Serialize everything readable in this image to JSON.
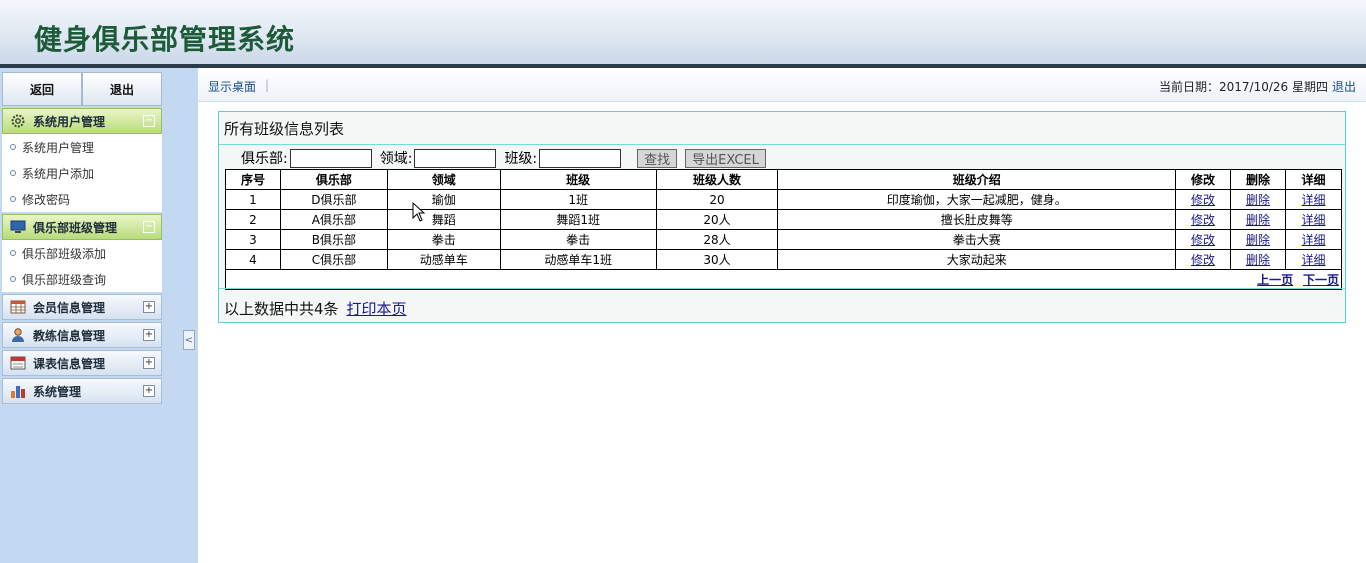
{
  "header": {
    "title": "健身俱乐部管理系统"
  },
  "sidebar": {
    "buttons": {
      "back": "返回",
      "exit": "退出"
    },
    "groups": [
      {
        "label": "系统用户管理",
        "open": true,
        "icon": "gear-icon",
        "toggle": "−",
        "items": [
          "系统用户管理",
          "系统用户添加",
          "修改密码"
        ]
      },
      {
        "label": "俱乐部班级管理",
        "open": true,
        "icon": "monitor-icon",
        "toggle": "−",
        "items": [
          "俱乐部班级添加",
          "俱乐部班级查询"
        ]
      },
      {
        "label": "会员信息管理",
        "open": false,
        "icon": "table-icon",
        "toggle": "+"
      },
      {
        "label": "教练信息管理",
        "open": false,
        "icon": "person-icon",
        "toggle": "+"
      },
      {
        "label": "课表信息管理",
        "open": false,
        "icon": "calendar-icon",
        "toggle": "+"
      },
      {
        "label": "系统管理",
        "open": false,
        "icon": "chart-icon",
        "toggle": "+"
      }
    ],
    "collapse_glyph": "<"
  },
  "topbar": {
    "desktop": "显示桌面",
    "separator": "|",
    "date": "当前日期：2017/10/26 星期四",
    "logout": "退出"
  },
  "panel": {
    "title": "所有班级信息列表",
    "filter": {
      "club_label": "俱乐部:",
      "field_label": "领域:",
      "class_label": "班级:",
      "search": "查找",
      "export": "导出EXCEL"
    },
    "columns": [
      "序号",
      "俱乐部",
      "领域",
      "班级",
      "班级人数",
      "班级介绍",
      "修改",
      "删除",
      "详细"
    ],
    "rows": [
      [
        "1",
        "D俱乐部",
        "瑜伽",
        "1班",
        "20",
        "印度瑜伽，大家一起减肥，健身。",
        "修改",
        "删除",
        "详细"
      ],
      [
        "2",
        "A俱乐部",
        "舞蹈",
        "舞蹈1班",
        "20人",
        "擅长肚皮舞等",
        "修改",
        "删除",
        "详细"
      ],
      [
        "3",
        "B俱乐部",
        "拳击",
        "拳击",
        "28人",
        "拳击大赛",
        "修改",
        "删除",
        "详细"
      ],
      [
        "4",
        "C俱乐部",
        "动感单车",
        "动感单车1班",
        "30人",
        "大家动起来",
        "修改",
        "删除",
        "详细"
      ]
    ],
    "pager": {
      "prev": "上一页",
      "next": "下一页"
    },
    "summary": "以上数据中共4条",
    "print": "打印本页"
  },
  "colors": {
    "accent_green": "#b8dc7a",
    "sidebar_bg": "#c3d8f1",
    "panel_border": "#56d2d2",
    "title_green": "#1d5a3a"
  }
}
